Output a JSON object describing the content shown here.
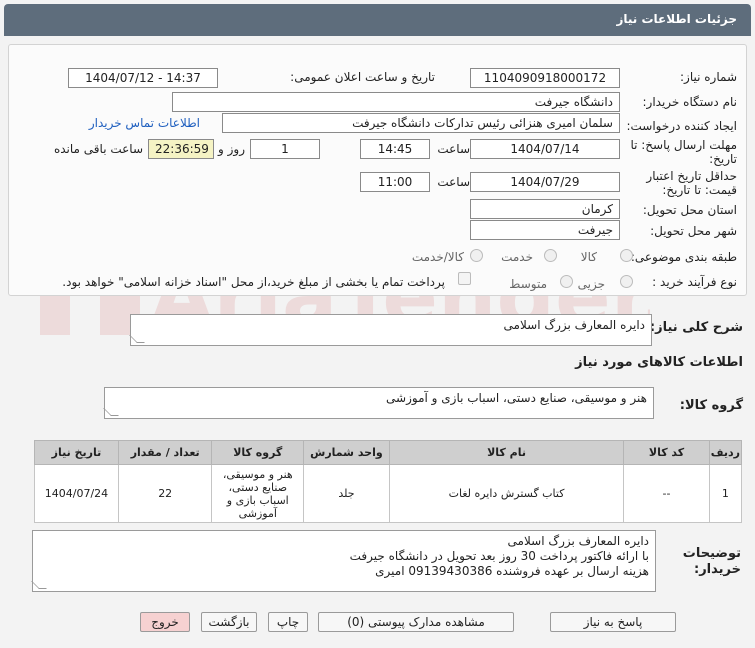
{
  "header": {
    "title": "جزئیات اطلاعات نیاز"
  },
  "form": {
    "need_number_label": "شماره نیاز:",
    "need_number": "1104090918000172",
    "announce_label": "تاریخ و ساعت اعلان عمومی:",
    "announce_value": "1404/07/12 - 14:37",
    "buyer_org_label": "نام دستگاه خریدار:",
    "buyer_org": "دانشگاه جیرفت",
    "creator_label": "ایجاد کننده درخواست:",
    "creator": "سلمان امیری هنزائی رئیس تدارکات دانشگاه جیرفت",
    "contact_link": "اطلاعات تماس خریدار",
    "deadline_label_1": "مهلت ارسال پاسخ: تا",
    "deadline_label_2": "تاریخ:",
    "deadline_date": "1404/07/14",
    "time_label": "ساعت",
    "deadline_time": "14:45",
    "days_value": "1",
    "days_label": "روز و",
    "remaining_time": "22:36:59",
    "remaining_label": "ساعت باقی مانده",
    "validity_label_1": "حداقل تاریخ اعتبار",
    "validity_label_2": "قیمت: تا تاریخ:",
    "validity_date": "1404/07/29",
    "validity_time_label": "ساعت",
    "validity_time": "11:00",
    "province_label": "استان محل تحویل:",
    "province": "کرمان",
    "city_label": "شهر محل تحویل:",
    "city": "جیرفت",
    "category_label": "طبقه بندی موضوعی:",
    "category_options": [
      "کالا",
      "خدمت",
      "کالا/خدمت"
    ],
    "process_label": "نوع فرآیند خرید :",
    "process_options": [
      "جزیی",
      "متوسط"
    ],
    "payment_note": "پرداخت تمام یا بخشی از مبلغ خرید،از محل \"اسناد خزانه اسلامی\" خواهد بود."
  },
  "summary": {
    "label": "شرح کلی نیاز:",
    "value": "دایره المعارف بزرگ اسلامی"
  },
  "goods_info": {
    "title": "اطلاعات کالاهای مورد نیاز",
    "group_label": "گروه کالا:",
    "group_value": "هنر و موسیقی، صنایع دستی، اسباب بازی و آموزشی"
  },
  "table": {
    "headers": [
      "ردیف",
      "کد کالا",
      "نام کالا",
      "واحد شمارش",
      "گروه کالا",
      "تعداد / مقدار",
      "تاریخ نیاز"
    ],
    "rows": [
      [
        "1",
        "--",
        "کتاب گسترش دایره لغات",
        "جلد",
        "هنر و موسیقی، صنایع دستی، اسباب بازی و آموزشی",
        "22",
        "1404/07/24"
      ]
    ]
  },
  "notes": {
    "label_1": "توضیحات",
    "label_2": "خریدار:",
    "line_1": "دایره المعارف بزرگ اسلامی",
    "line_2": "با ارائه فاکتور پرداخت 30 روز بعد تحویل در دانشگاه جیرفت",
    "line_3": "هزینه ارسال بر عهده فروشنده 09139430386 امیری"
  },
  "buttons": {
    "reply": "پاسخ به نیاز",
    "attachments": "مشاهده مدارک پیوستی (0)",
    "print": "چاپ",
    "back": "بازگشت",
    "exit": "خروج"
  },
  "watermark_text": "AriaTender.neT"
}
